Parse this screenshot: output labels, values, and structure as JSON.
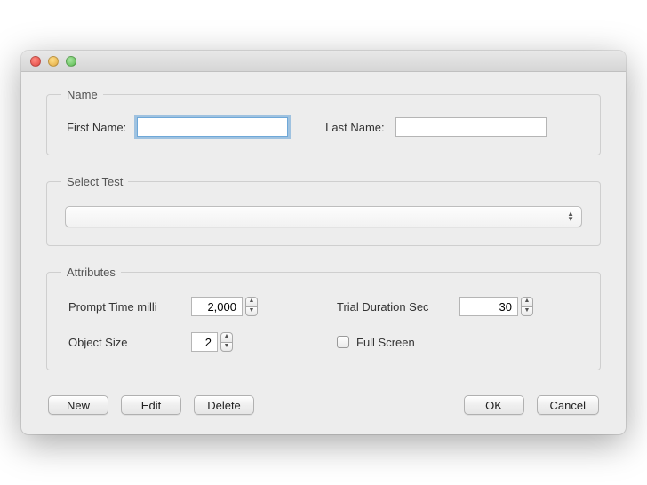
{
  "name_group": {
    "legend": "Name",
    "first_label": "First Name:",
    "first_value": "",
    "last_label": "Last Name:",
    "last_value": ""
  },
  "select_group": {
    "legend": "Select Test",
    "selected": ""
  },
  "attributes_group": {
    "legend": "Attributes",
    "prompt_label": "Prompt Time milli",
    "prompt_value": "2,000",
    "trial_label": "Trial Duration Sec",
    "trial_value": "30",
    "objsize_label": "Object Size",
    "objsize_value": "2",
    "fullscreen_label": "Full Screen",
    "fullscreen_checked": false
  },
  "buttons": {
    "new": "New",
    "edit": "Edit",
    "delete": "Delete",
    "ok": "OK",
    "cancel": "Cancel"
  }
}
